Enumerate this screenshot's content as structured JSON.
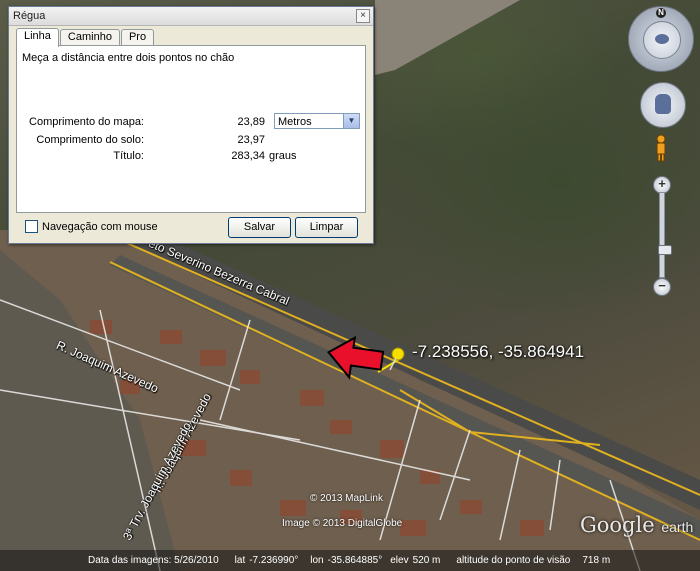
{
  "map": {
    "road_label_1": "eto Severino Bezerra Cabral",
    "road_label_2": "R. Joaquim Azevedo",
    "road_label_3": "R. Joaquim Azevedo",
    "road_label_4": "3ª Trv. Joaquim Azevedo",
    "pin_coordinates": "-7.238556, -35.864941",
    "copyright_1": "© 2013 MapLink",
    "copyright_2": "Image © 2013 DigitalGlobe",
    "logo_text": "Google",
    "logo_suffix": "earth"
  },
  "statusbar": {
    "date_label": "Data das imagens: 5/26/2010",
    "lat_label": "lat",
    "lat_value": "-7.236990°",
    "lon_label": "lon",
    "lon_value": "-35.864885°",
    "elev_label": "elev",
    "elev_value": "520 m",
    "eye_alt_label": "altitude do ponto de visão",
    "eye_alt_value": "718 m"
  },
  "nav": {
    "north_label": "N",
    "zoom_in": "+",
    "zoom_out": "−"
  },
  "dialog": {
    "title": "Régua",
    "close": "×",
    "tabs": [
      {
        "label": "Linha"
      },
      {
        "label": "Caminho"
      },
      {
        "label": "Pro"
      }
    ],
    "description": "Meça a distância entre dois pontos no chão",
    "map_length_label": "Comprimento do mapa:",
    "map_length_value": "23,89",
    "unit_select": "Metros",
    "ground_length_label": "Comprimento do solo:",
    "ground_length_value": "23,97",
    "heading_label": "Título:",
    "heading_value": "283,34",
    "heading_unit": "graus",
    "mouse_nav_label": "Navegação com mouse",
    "save_label": "Salvar",
    "clear_label": "Limpar"
  },
  "colors": {
    "annotation_arrow": "#e8102a",
    "road_line": "#e0b020",
    "pin": "#f5e000"
  }
}
